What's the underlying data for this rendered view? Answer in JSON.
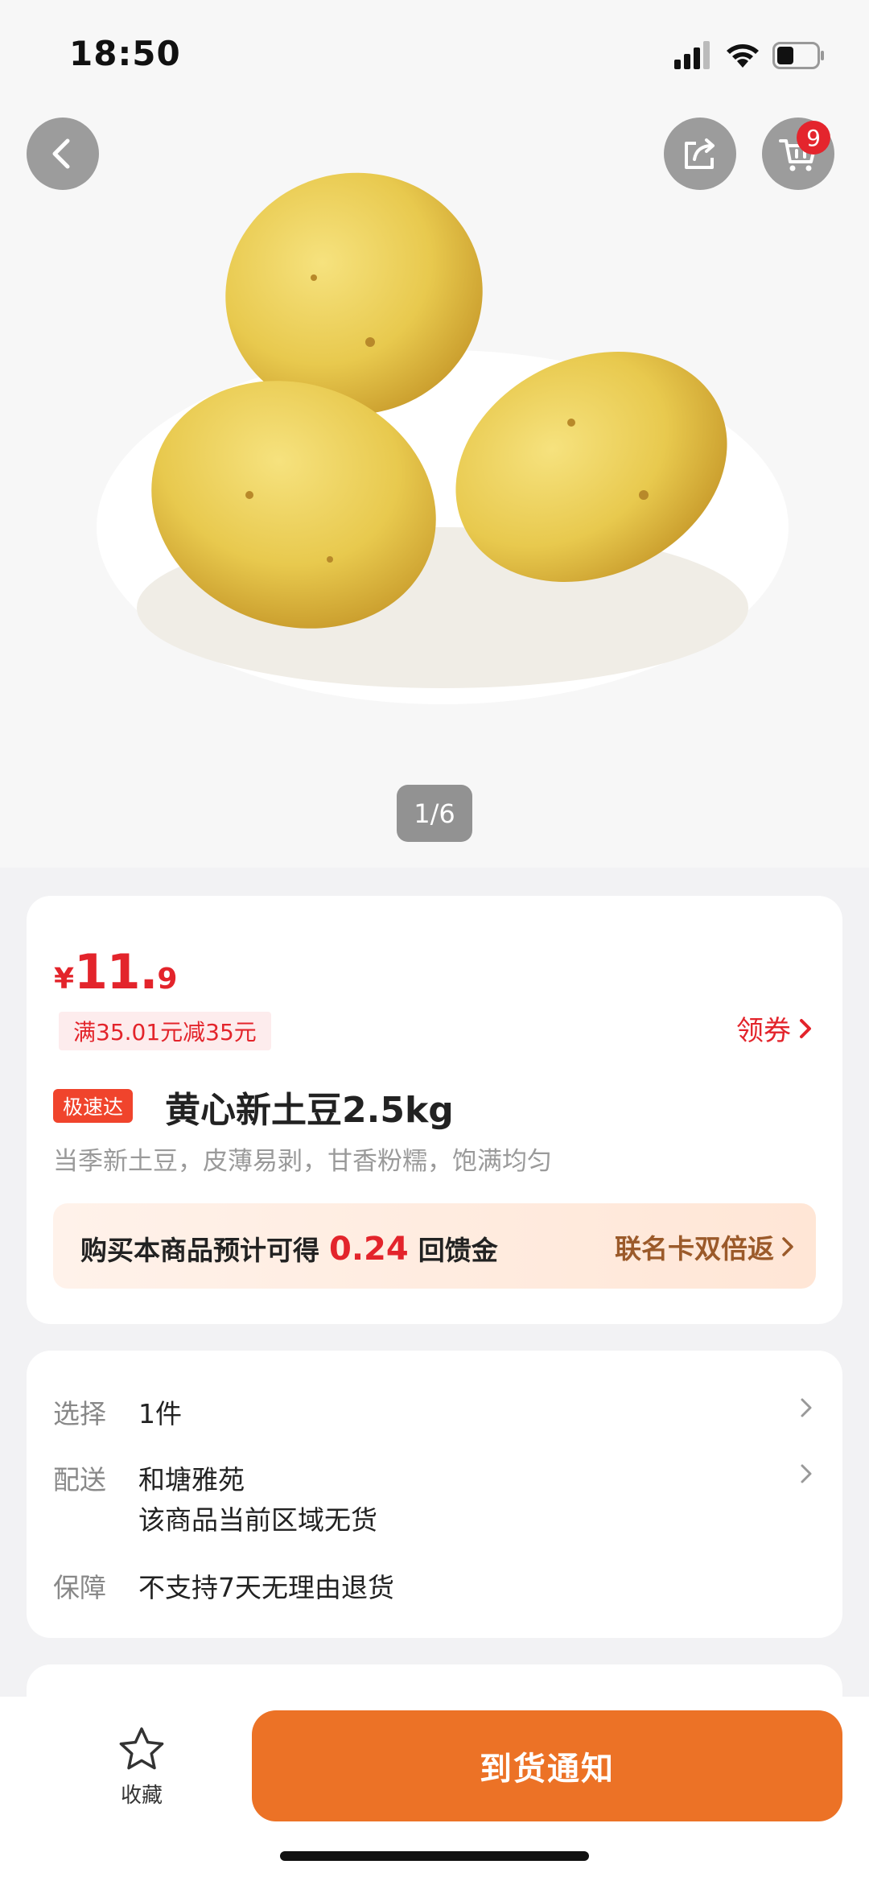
{
  "status": {
    "time": "18:50"
  },
  "header": {
    "cart_badge": "9"
  },
  "gallery": {
    "pager": "1/6"
  },
  "product": {
    "price_currency": "¥",
    "price_integer": "11.",
    "price_decimal": "9",
    "coupon_tag": "满35.01元减35元",
    "coupon_link": "领券",
    "express_tag": "极速达",
    "title": "黄心新土豆2.5kg",
    "subtitle": "当季新土豆，皮薄易剥，甘香粉糯，饱满均匀"
  },
  "reward": {
    "prefix": "购买本商品预计可得",
    "amount": "0.24",
    "suffix": "回馈金",
    "link": "联名卡双倍返"
  },
  "options": {
    "select_label": "选择",
    "select_value": "1件",
    "delivery_label": "配送",
    "delivery_value": "和塘雅苑",
    "delivery_note": "该商品当前区域无货",
    "guarantee_label": "保障",
    "guarantee_value": "不支持7天无理由退货"
  },
  "bottom": {
    "favorite_label": "收藏",
    "notify_label": "到货通知"
  },
  "colors": {
    "accent_red": "#e3242b",
    "button_orange": "#ec7226"
  },
  "icons": [
    "back-icon",
    "share-icon",
    "cart-icon",
    "star-icon",
    "chevron-right-icon",
    "signal-icon",
    "wifi-icon",
    "battery-icon"
  ]
}
